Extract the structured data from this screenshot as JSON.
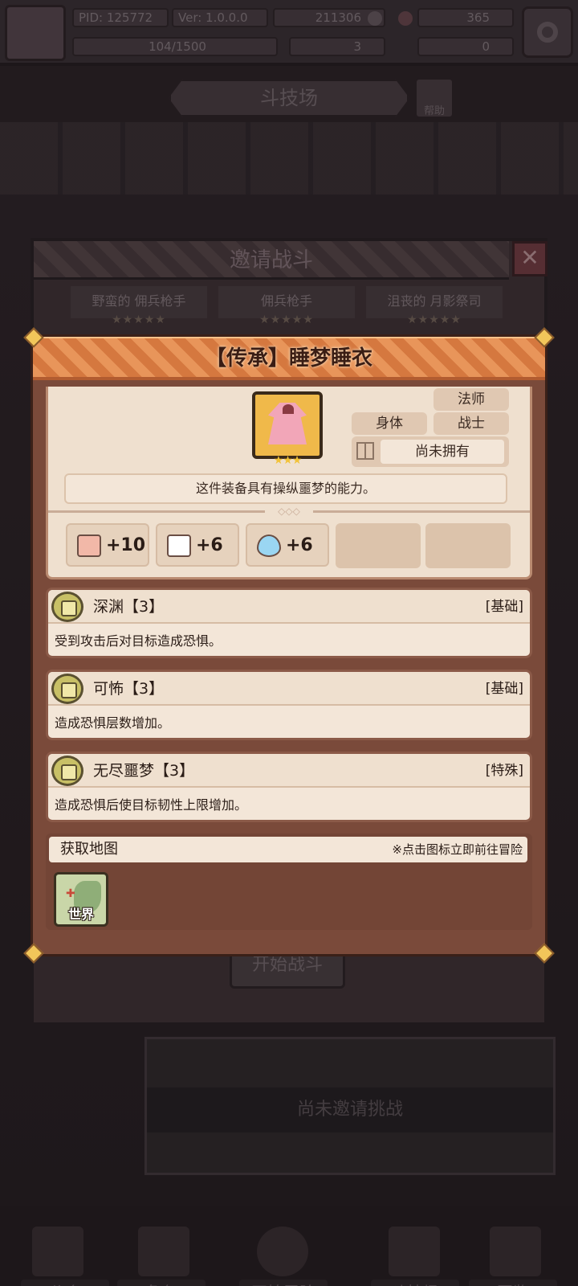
{
  "top_bar": {
    "pid": "PID: 125772",
    "version": "Ver: 1.0.0.0",
    "gold": "211306",
    "gems": "365",
    "exp": "104/1500",
    "count_a": "3",
    "count_b": "0"
  },
  "arena": {
    "title": "斗技场",
    "help_label": "帮助"
  },
  "invite_dialog": {
    "title": "邀请战斗",
    "opponents": [
      {
        "name": "野蛮的 佣兵枪手",
        "stars": "★★★★★"
      },
      {
        "name": "佣兵枪手",
        "stars": "★★★★★"
      },
      {
        "name": "沮丧的 月影祭司",
        "stars": "★★★★★"
      }
    ],
    "start_button": "开始战斗"
  },
  "status_panel": {
    "text": "尚未邀请挑战"
  },
  "item": {
    "title": "【传承】睡梦睡衣",
    "stars": "★★★",
    "slot": "身体",
    "classes": [
      "法师",
      "战士"
    ],
    "ownership": "尚未拥有",
    "description": "这件装备具有操纵噩梦的能力。",
    "divider_glyph": "◇◇◇",
    "stats": [
      {
        "icon": "fist-icon",
        "value": "+10"
      },
      {
        "icon": "book-icon",
        "value": "+6"
      },
      {
        "icon": "water-drop-icon",
        "value": "+6"
      }
    ],
    "skills": [
      {
        "name": "深渊【3】",
        "type": "[基础]",
        "desc": "受到攻击后对目标造成恐惧。"
      },
      {
        "name": "可怖【3】",
        "type": "[基础]",
        "desc": "造成恐惧层数增加。"
      },
      {
        "name": "无尽噩梦【3】",
        "type": "[特殊]",
        "desc": "造成恐惧后使目标韧性上限增加。"
      }
    ],
    "map": {
      "title": "获取地图",
      "hint": "※点击图标立即前往冒险",
      "world_label": "世界"
    }
  },
  "bottom_nav": [
    "公会",
    "角色",
    "开始冒险",
    "斗技场",
    "图鉴"
  ]
}
